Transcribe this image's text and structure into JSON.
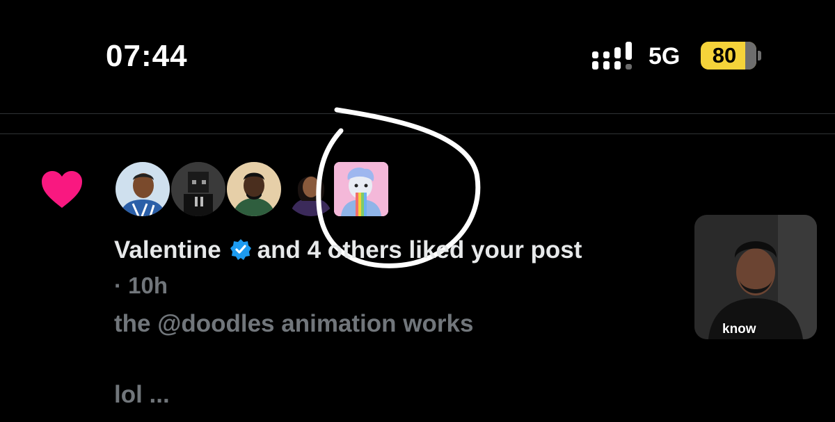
{
  "status_bar": {
    "time": "07:44",
    "network": "5G",
    "battery": "80",
    "battery_level": 0.8
  },
  "notification": {
    "type_icon": "heart-icon",
    "avatars": [
      {
        "icon": "avatar-cartoon-man"
      },
      {
        "icon": "avatar-pixel-character"
      },
      {
        "icon": "avatar-man-green-hoodie"
      },
      {
        "icon": "avatar-woman-purple-hoodie"
      },
      {
        "icon": "avatar-doodles-nft"
      }
    ],
    "name": "Valentine",
    "rest": "and 4 others liked your post",
    "timestamp": "· 10h",
    "post_text_1": "the  @doodles  animation works",
    "post_text_2": "lol ...",
    "thumbnail_caption": "know"
  },
  "colors": {
    "heart": "#f91880",
    "verified": "#1d9bf0",
    "battery": "#f5d33a"
  }
}
